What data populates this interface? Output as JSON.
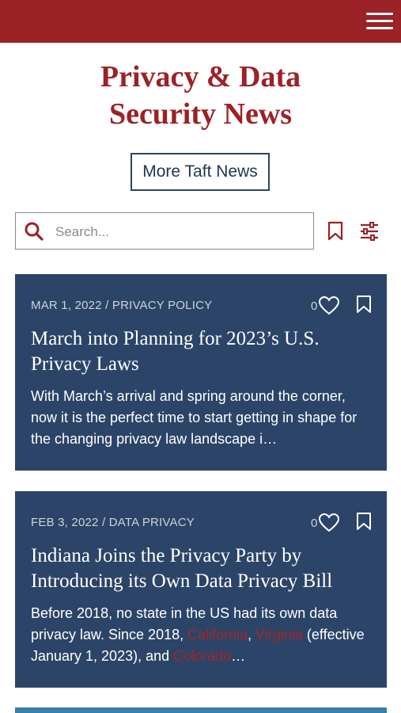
{
  "header": {
    "menu_icon": "hamburger-menu-icon",
    "brand_color": "#9b2226"
  },
  "page": {
    "title_line1": "Privacy & Data",
    "title_line2": "Security News",
    "more_news_label": "More Taft News"
  },
  "search": {
    "placeholder": "Search...",
    "value": "",
    "icons": [
      "search-icon",
      "bookmark-icon",
      "filter-sliders-icon"
    ]
  },
  "articles": [
    {
      "date": "MAR 1, 2022",
      "category": "PRIVACY POLICY",
      "likes": "0",
      "title": "March into Planning for 2023’s U.S. Privacy Laws",
      "excerpt": "With March’s arrival and spring around the corner, now it is the perfect time to start getting in shape for the changing privacy law landscape i…"
    },
    {
      "date": "FEB 3, 2022",
      "category": "DATA PRIVACY",
      "likes": "0",
      "title": "Indiana Joins the Privacy Party by Introducing its Own Data Privacy Bill",
      "excerpt_part1": "Before 2018, no state in the US had its own data privacy law. Since 2018, ",
      "link1": "California",
      "sep1": ", ",
      "link2": "Virginia",
      "excerpt_part2": " (effective January 1, 2023), and ",
      "link3": "Colorado",
      "ellipsis": "…"
    }
  ],
  "colors": {
    "card_bg": "#2c4467",
    "link": "#a0272c",
    "button_border": "#2e4460"
  }
}
